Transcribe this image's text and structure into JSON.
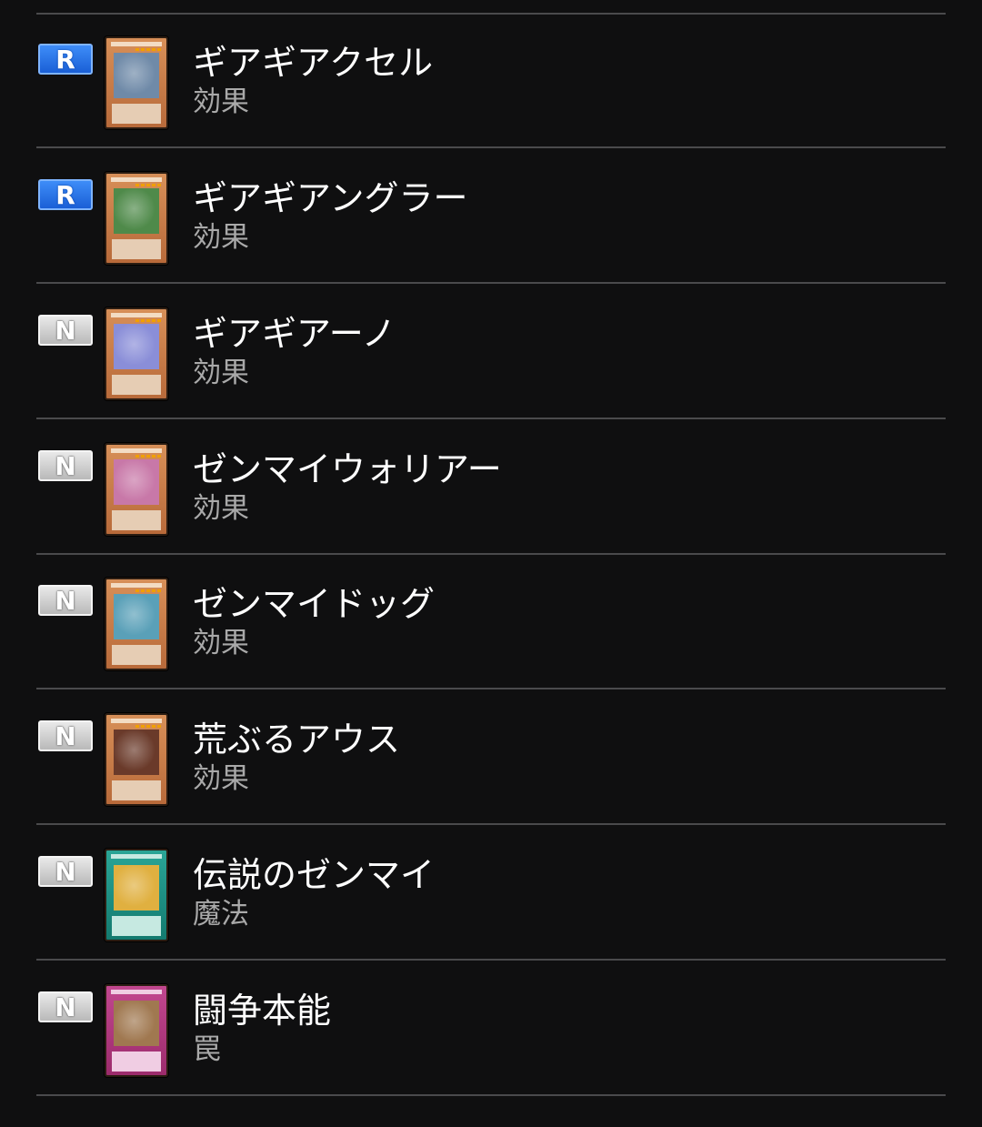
{
  "cards": [
    {
      "rarity": "R",
      "name": "ギアギアクセル",
      "type": "効果",
      "frame": "effect",
      "art": "#6f8aa8"
    },
    {
      "rarity": "R",
      "name": "ギアギアングラー",
      "type": "効果",
      "frame": "effect",
      "art": "#4f8a4a"
    },
    {
      "rarity": "N",
      "name": "ギアギアーノ",
      "type": "効果",
      "frame": "effect",
      "art": "#8a8ed8"
    },
    {
      "rarity": "N",
      "name": "ゼンマイウォリアー",
      "type": "効果",
      "frame": "effect",
      "art": "#c878a8"
    },
    {
      "rarity": "N",
      "name": "ゼンマイドッグ",
      "type": "効果",
      "frame": "effect",
      "art": "#5aa0b8"
    },
    {
      "rarity": "N",
      "name": "荒ぶるアウス",
      "type": "効果",
      "frame": "effect",
      "art": "#6a3a2a"
    },
    {
      "rarity": "N",
      "name": "伝説のゼンマイ",
      "type": "魔法",
      "frame": "spell",
      "art": "#e0b040"
    },
    {
      "rarity": "N",
      "name": "闘争本能",
      "type": "罠",
      "frame": "trap",
      "art": "#a07850"
    }
  ]
}
